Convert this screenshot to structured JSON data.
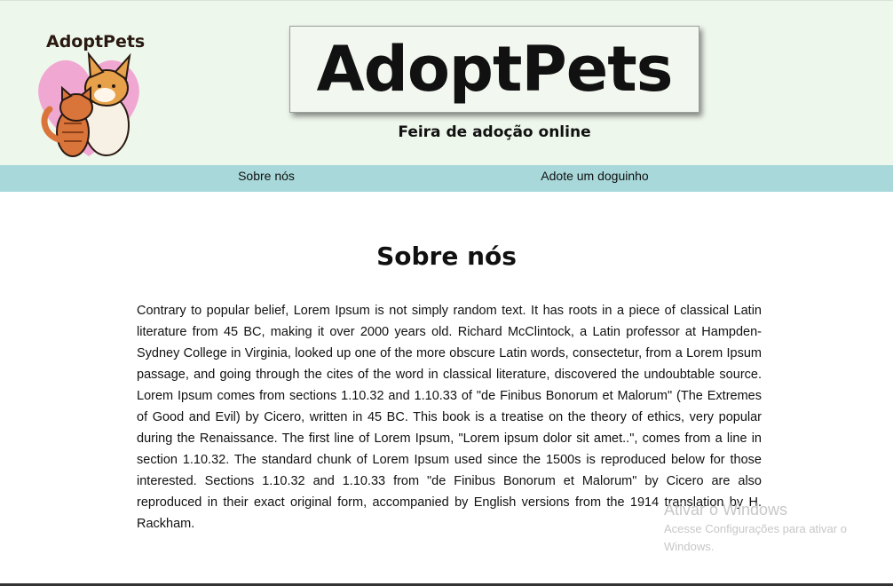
{
  "header": {
    "logo_text": "AdoptPets",
    "title": "AdoptPets",
    "subtitle": "Feira de adoção online"
  },
  "nav": {
    "items": [
      {
        "label": "Sobre nós"
      },
      {
        "label": "Adote um doguinho"
      }
    ]
  },
  "main": {
    "title": "Sobre nós",
    "paragraph": "Contrary to popular belief, Lorem Ipsum is not simply random text. It has roots in a piece of classical Latin literature from 45 BC, making it over 2000 years old. Richard McClintock, a Latin professor at Hampden-Sydney College in Virginia, looked up one of the more obscure Latin words, consectetur, from a Lorem Ipsum passage, and going through the cites of the word in classical literature, discovered the undoubtable source. Lorem Ipsum comes from sections 1.10.32 and 1.10.33 of \"de Finibus Bonorum et Malorum\" (The Extremes of Good and Evil) by Cicero, written in 45 BC. This book is a treatise on the theory of ethics, very popular during the Renaissance. The first line of Lorem Ipsum, \"Lorem ipsum dolor sit amet..\", comes from a line in section 1.10.32. The standard chunk of Lorem Ipsum used since the 1500s is reproduced below for those interested. Sections 1.10.32 and 1.10.33 from \"de Finibus Bonorum et Malorum\" by Cicero are also reproduced in their exact original form, accompanied by English versions from the 1914 translation by H. Rackham."
  },
  "watermark": {
    "title": "Ativar o Windows",
    "subtitle": "Acesse Configurações para ativar o Windows."
  },
  "colors": {
    "header_bg": "#eef7ec",
    "nav_bg": "#a8d8da",
    "heart": "#f0a8d2"
  }
}
